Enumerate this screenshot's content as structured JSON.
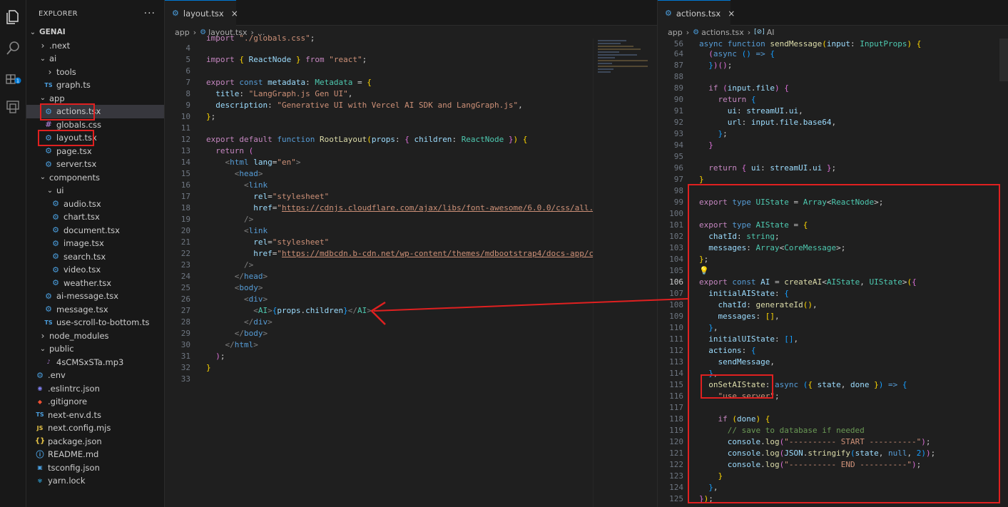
{
  "sidebar": {
    "title": "EXPLORER",
    "more": "···",
    "tree": [
      {
        "label": "GENAI",
        "icon": "chevron-down",
        "indent": 0,
        "kind": "folder-root"
      },
      {
        "label": ".next",
        "icon": "chevron-right",
        "indent": 1,
        "kind": "folder"
      },
      {
        "label": "ai",
        "icon": "chevron-down",
        "indent": 1,
        "kind": "folder"
      },
      {
        "label": "tools",
        "icon": "chevron-right",
        "indent": 2,
        "kind": "folder"
      },
      {
        "label": "graph.ts",
        "icon": "TS",
        "indent": 1,
        "kind": "ts"
      },
      {
        "label": "app",
        "icon": "chevron-down",
        "indent": 1,
        "kind": "folder"
      },
      {
        "label": "actions.tsx",
        "icon": "gear",
        "indent": 1,
        "kind": "gear",
        "selected": true
      },
      {
        "label": "globals.css",
        "icon": "#",
        "indent": 1,
        "kind": "hash"
      },
      {
        "label": "layout.tsx",
        "icon": "gear",
        "indent": 1,
        "kind": "gear"
      },
      {
        "label": "page.tsx",
        "icon": "gear",
        "indent": 1,
        "kind": "gear"
      },
      {
        "label": "server.tsx",
        "icon": "gear",
        "indent": 1,
        "kind": "gear"
      },
      {
        "label": "components",
        "icon": "chevron-down",
        "indent": 1,
        "kind": "folder"
      },
      {
        "label": "ui",
        "icon": "chevron-down",
        "indent": 2,
        "kind": "folder"
      },
      {
        "label": "audio.tsx",
        "icon": "gear",
        "indent": 2,
        "kind": "gear"
      },
      {
        "label": "chart.tsx",
        "icon": "gear",
        "indent": 2,
        "kind": "gear"
      },
      {
        "label": "document.tsx",
        "icon": "gear",
        "indent": 2,
        "kind": "gear"
      },
      {
        "label": "image.tsx",
        "icon": "gear",
        "indent": 2,
        "kind": "gear"
      },
      {
        "label": "search.tsx",
        "icon": "gear",
        "indent": 2,
        "kind": "gear"
      },
      {
        "label": "video.tsx",
        "icon": "gear",
        "indent": 2,
        "kind": "gear"
      },
      {
        "label": "weather.tsx",
        "icon": "gear",
        "indent": 2,
        "kind": "gear"
      },
      {
        "label": "ai-message.tsx",
        "icon": "gear",
        "indent": 1,
        "kind": "gear"
      },
      {
        "label": "message.tsx",
        "icon": "gear",
        "indent": 1,
        "kind": "gear"
      },
      {
        "label": "use-scroll-to-bottom.ts",
        "icon": "TS",
        "indent": 1,
        "kind": "ts"
      },
      {
        "label": "node_modules",
        "icon": "chevron-right",
        "indent": 1,
        "kind": "folder"
      },
      {
        "label": "public",
        "icon": "chevron-down",
        "indent": 1,
        "kind": "folder"
      },
      {
        "label": "4sCMSxSTa.mp3",
        "icon": "audio",
        "indent": 1,
        "kind": "audio"
      },
      {
        "label": ".env",
        "icon": "gear",
        "indent": 0,
        "kind": "gear"
      },
      {
        "label": ".eslintrc.json",
        "icon": "eslint",
        "indent": 0,
        "kind": "eslint"
      },
      {
        "label": ".gitignore",
        "icon": "git",
        "indent": 0,
        "kind": "git"
      },
      {
        "label": "next-env.d.ts",
        "icon": "TS",
        "indent": 0,
        "kind": "ts"
      },
      {
        "label": "next.config.mjs",
        "icon": "JS",
        "indent": 0,
        "kind": "js"
      },
      {
        "label": "package.json",
        "icon": "{}",
        "indent": 0,
        "kind": "brace"
      },
      {
        "label": "README.md",
        "icon": "info",
        "indent": 0,
        "kind": "info"
      },
      {
        "label": "tsconfig.json",
        "icon": "tsconfig",
        "indent": 0,
        "kind": "tsconfig"
      },
      {
        "label": "yarn.lock",
        "icon": "yarn",
        "indent": 0,
        "kind": "yarn"
      }
    ]
  },
  "editor_left": {
    "tab": {
      "label": "layout.tsx",
      "close": "×"
    },
    "breadcrumb": [
      "app",
      "layout.tsx",
      "..."
    ]
  },
  "editor_right": {
    "tab": {
      "label": "actions.tsx",
      "close": "×"
    },
    "breadcrumb": [
      "app",
      "actions.tsx",
      "AI"
    ]
  },
  "colors": {
    "annotation": "#e02020",
    "accent": "#0078d4"
  }
}
